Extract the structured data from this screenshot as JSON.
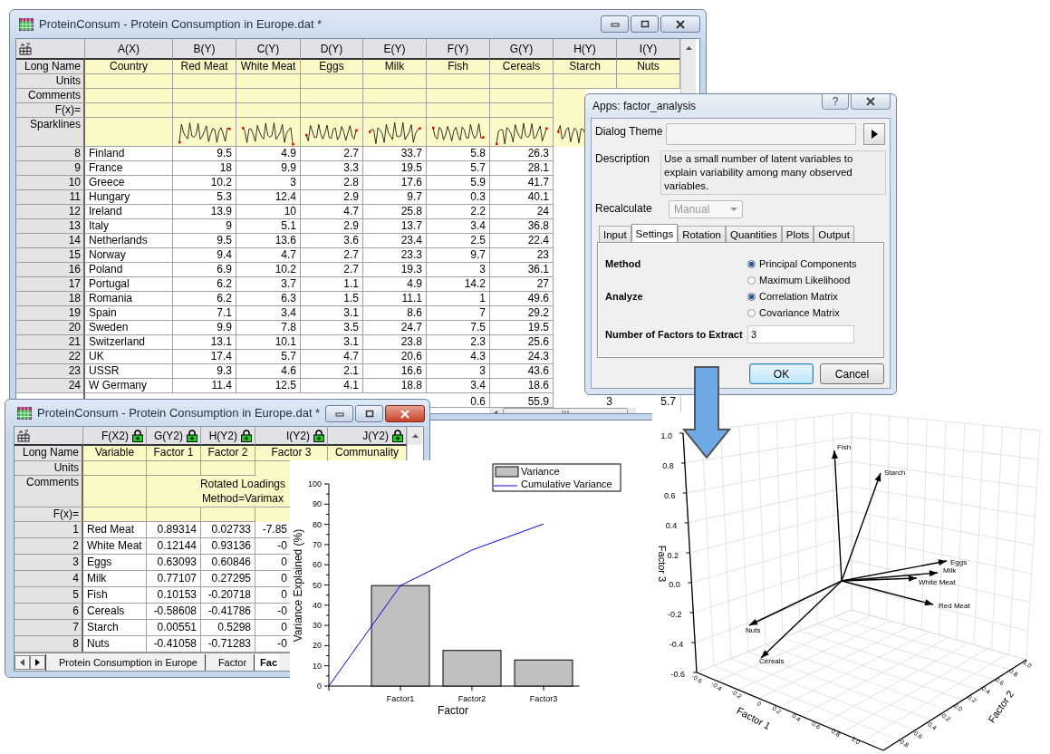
{
  "worksheet": {
    "title": "ProteinConsum - Protein Consumption in Europe.dat *",
    "columns": [
      {
        "name": "A(X)",
        "long_name": "Country",
        "sparkline": false
      },
      {
        "name": "B(Y)",
        "long_name": "Red Meat",
        "sparkline": true
      },
      {
        "name": "C(Y)",
        "long_name": "White Meat",
        "sparkline": true
      },
      {
        "name": "D(Y)",
        "long_name": "Eggs",
        "sparkline": true
      },
      {
        "name": "E(Y)",
        "long_name": "Milk",
        "sparkline": true
      },
      {
        "name": "F(Y)",
        "long_name": "Fish",
        "sparkline": true
      },
      {
        "name": "G(Y)",
        "long_name": "Cereals",
        "sparkline": true
      },
      {
        "name": "H(Y)",
        "long_name": "Starch",
        "sparkline": true
      },
      {
        "name": "I(Y)",
        "long_name": "Nuts"
      }
    ],
    "label_rows": [
      {
        "label": "Long Name",
        "kind": "long_name"
      },
      {
        "label": "Units",
        "kind": "blank"
      },
      {
        "label": "Comments",
        "kind": "blank"
      },
      {
        "label": "F(x)=",
        "kind": "blank"
      },
      {
        "label": "Sparklines",
        "kind": "sparklines"
      }
    ],
    "rows": [
      {
        "number": "8",
        "cells": [
          "Finland",
          "9.5",
          "4.9",
          "2.7",
          "33.7",
          "5.8",
          "26.3"
        ]
      },
      {
        "number": "9",
        "cells": [
          "France",
          "18",
          "9.9",
          "3.3",
          "19.5",
          "5.7",
          "28.1"
        ]
      },
      {
        "number": "10",
        "cells": [
          "Greece",
          "10.2",
          "3",
          "2.8",
          "17.6",
          "5.9",
          "41.7"
        ]
      },
      {
        "number": "11",
        "cells": [
          "Hungary",
          "5.3",
          "12.4",
          "2.9",
          "9.7",
          "0.3",
          "40.1"
        ]
      },
      {
        "number": "12",
        "cells": [
          "Ireland",
          "13.9",
          "10",
          "4.7",
          "25.8",
          "2.2",
          "24"
        ]
      },
      {
        "number": "13",
        "cells": [
          "Italy",
          "9",
          "5.1",
          "2.9",
          "13.7",
          "3.4",
          "36.8"
        ]
      },
      {
        "number": "14",
        "cells": [
          "Netherlands",
          "9.5",
          "13.6",
          "3.6",
          "23.4",
          "2.5",
          "22.4"
        ]
      },
      {
        "number": "15",
        "cells": [
          "Norway",
          "9.4",
          "4.7",
          "2.7",
          "23.3",
          "9.7",
          "23"
        ]
      },
      {
        "number": "16",
        "cells": [
          "Poland",
          "6.9",
          "10.2",
          "2.7",
          "19.3",
          "3",
          "36.1"
        ]
      },
      {
        "number": "17",
        "cells": [
          "Portugal",
          "6.2",
          "3.7",
          "1.1",
          "4.9",
          "14.2",
          "27"
        ]
      },
      {
        "number": "18",
        "cells": [
          "Romania",
          "6.2",
          "6.3",
          "1.5",
          "11.1",
          "1",
          "49.6"
        ]
      },
      {
        "number": "19",
        "cells": [
          "Spain",
          "7.1",
          "3.4",
          "3.1",
          "8.6",
          "7",
          "29.2"
        ]
      },
      {
        "number": "20",
        "cells": [
          "Sweden",
          "9.9",
          "7.8",
          "3.5",
          "24.7",
          "7.5",
          "19.5"
        ]
      },
      {
        "number": "21",
        "cells": [
          "Switzerland",
          "13.1",
          "10.1",
          "3.1",
          "23.8",
          "2.3",
          "25.6"
        ]
      },
      {
        "number": "22",
        "cells": [
          "UK",
          "17.4",
          "5.7",
          "4.7",
          "20.6",
          "4.3",
          "24.3"
        ]
      },
      {
        "number": "23",
        "cells": [
          "USSR",
          "9.3",
          "4.6",
          "2.1",
          "16.6",
          "3",
          "43.6"
        ]
      },
      {
        "number": "24",
        "cells": [
          "W Germany",
          "11.4",
          "12.5",
          "4.1",
          "18.8",
          "3.4",
          "18.6"
        ]
      }
    ],
    "partial_row": {
      "cells": [
        "0.6",
        "55.9",
        "3",
        "5.7"
      ]
    }
  },
  "dialog": {
    "title": "Apps: factor_analysis",
    "help_button": "?",
    "theme_label": "Dialog Theme",
    "description_label": "Description",
    "description": "Use a small number of latent variables to explain variability among many observed variables.",
    "recalculate_label": "Recalculate",
    "recalculate": {
      "value": "Manual",
      "disabled": true
    },
    "tabs": [
      {
        "label": "Input",
        "selected": false
      },
      {
        "label": "Settings",
        "selected": true
      },
      {
        "label": "Rotation",
        "selected": false
      },
      {
        "label": "Quantities",
        "selected": false
      },
      {
        "label": "Plots",
        "selected": false
      },
      {
        "label": "Output",
        "selected": false
      }
    ],
    "settings": [
      {
        "kind": "radio_group",
        "label": "Method",
        "options": [
          {
            "label": "Principal Components",
            "selected": true
          },
          {
            "label": "Maximum Likelihood",
            "selected": false
          }
        ]
      },
      {
        "kind": "radio_group",
        "label": "Analyze",
        "options": [
          {
            "label": "Correlation Matrix",
            "selected": true
          },
          {
            "label": "Covariance Matrix",
            "selected": false
          }
        ]
      },
      {
        "kind": "input",
        "label": "Number of Factors to Extract",
        "value": "3"
      }
    ],
    "buttons": [
      {
        "label": "OK",
        "default": true
      },
      {
        "label": "Cancel",
        "default": false
      }
    ]
  },
  "results": {
    "title": "ProteinConsum - Protein Consumption in Europe.dat *",
    "columns": [
      {
        "name": "F(X2)",
        "long_name": "Variable",
        "locked": true
      },
      {
        "name": "G(Y2)",
        "long_name": "Factor 1",
        "locked": true
      },
      {
        "name": "H(Y2)",
        "long_name": "Factor 2",
        "locked": true
      },
      {
        "name": "I(Y2)",
        "long_name": "Factor 3",
        "locked": true
      },
      {
        "name": "J(Y2)",
        "long_name": "Communality",
        "locked": true
      }
    ],
    "label_rows": [
      {
        "label": "Long Name",
        "kind": "long_name"
      },
      {
        "label": "Units",
        "kind": "blank"
      },
      {
        "label": "Comments",
        "kind": "comment",
        "text": "Rotated Loadings\nMethod=Varimax"
      },
      {
        "label": "F(x)=",
        "kind": "blank"
      }
    ],
    "rows": [
      {
        "number": "1",
        "cells": [
          "Red Meat",
          "0.89314",
          "0.02733",
          "-7.85"
        ]
      },
      {
        "number": "2",
        "cells": [
          "White Meat",
          "0.12144",
          "0.93136",
          "-0"
        ]
      },
      {
        "number": "3",
        "cells": [
          "Eggs",
          "0.63093",
          "0.60846",
          "0"
        ]
      },
      {
        "number": "4",
        "cells": [
          "Milk",
          "0.77107",
          "0.27295",
          "0"
        ]
      },
      {
        "number": "5",
        "cells": [
          "Fish",
          "0.10153",
          "-0.20718",
          "0"
        ]
      },
      {
        "number": "6",
        "cells": [
          "Cereals",
          "-0.58608",
          "-0.41786",
          "-0"
        ]
      },
      {
        "number": "7",
        "cells": [
          "Starch",
          "0.00551",
          "0.5298",
          "0"
        ]
      },
      {
        "number": "8",
        "cells": [
          "Nuts",
          "-0.41058",
          "-0.71283",
          "-0"
        ]
      }
    ],
    "sheet_tabs": [
      {
        "label": "Protein Consumption in Europe",
        "selected": false
      },
      {
        "label": "Factor",
        "selected": false
      },
      {
        "label": "Fac",
        "selected": true
      }
    ]
  },
  "variance_chart": {
    "chart_data": {
      "type": "bar",
      "xlabel": "Factor",
      "ylabel": "Variance Explained (%)",
      "categories": [
        null,
        "Factor1",
        "Factor2",
        "Factor3"
      ],
      "series": [
        {
          "name": "Variance",
          "type": "bar",
          "color": "#c0c0c0",
          "values": [
            null,
            49.7,
            17.6,
            12.9
          ]
        },
        {
          "name": "Cumulative Variance",
          "type": "line",
          "color": "#0000ff",
          "values": [
            0,
            49.7,
            67.3,
            80.2
          ]
        }
      ],
      "ylim": [
        0,
        100
      ],
      "yticks": [
        0,
        10,
        20,
        30,
        40,
        50,
        60,
        70,
        80,
        90,
        100
      ],
      "legend": "upper right"
    }
  },
  "vector_plot": {
    "z_axis_title": "Factor 3",
    "x_axis_title": "Factor 1",
    "y_axis_title": "Factor 2",
    "z_ticks": [
      "1.0",
      "0.8",
      "0.6",
      "0.4",
      "0.2",
      "0.0",
      "-0.2",
      "-0.4",
      "-0.6"
    ],
    "x_ticks": [
      "-0.6",
      "-0.4",
      "-0.2",
      "0",
      "0.2",
      "0.4",
      "0.6",
      "0.8",
      "1.0"
    ],
    "y_ticks": [
      "-0.8",
      "-0.6",
      "-0.4",
      "-0.2",
      "0.0",
      "0.2",
      "0.4",
      "0.6",
      "0.8",
      "1.0"
    ],
    "vectors": [
      {
        "label": "Fish"
      },
      {
        "label": "Starch"
      },
      {
        "label": "Eggs"
      },
      {
        "label": "Milk"
      },
      {
        "label": "White Meat"
      },
      {
        "label": "Red Meat"
      },
      {
        "label": "Nuts"
      },
      {
        "label": "Cereals"
      }
    ]
  }
}
